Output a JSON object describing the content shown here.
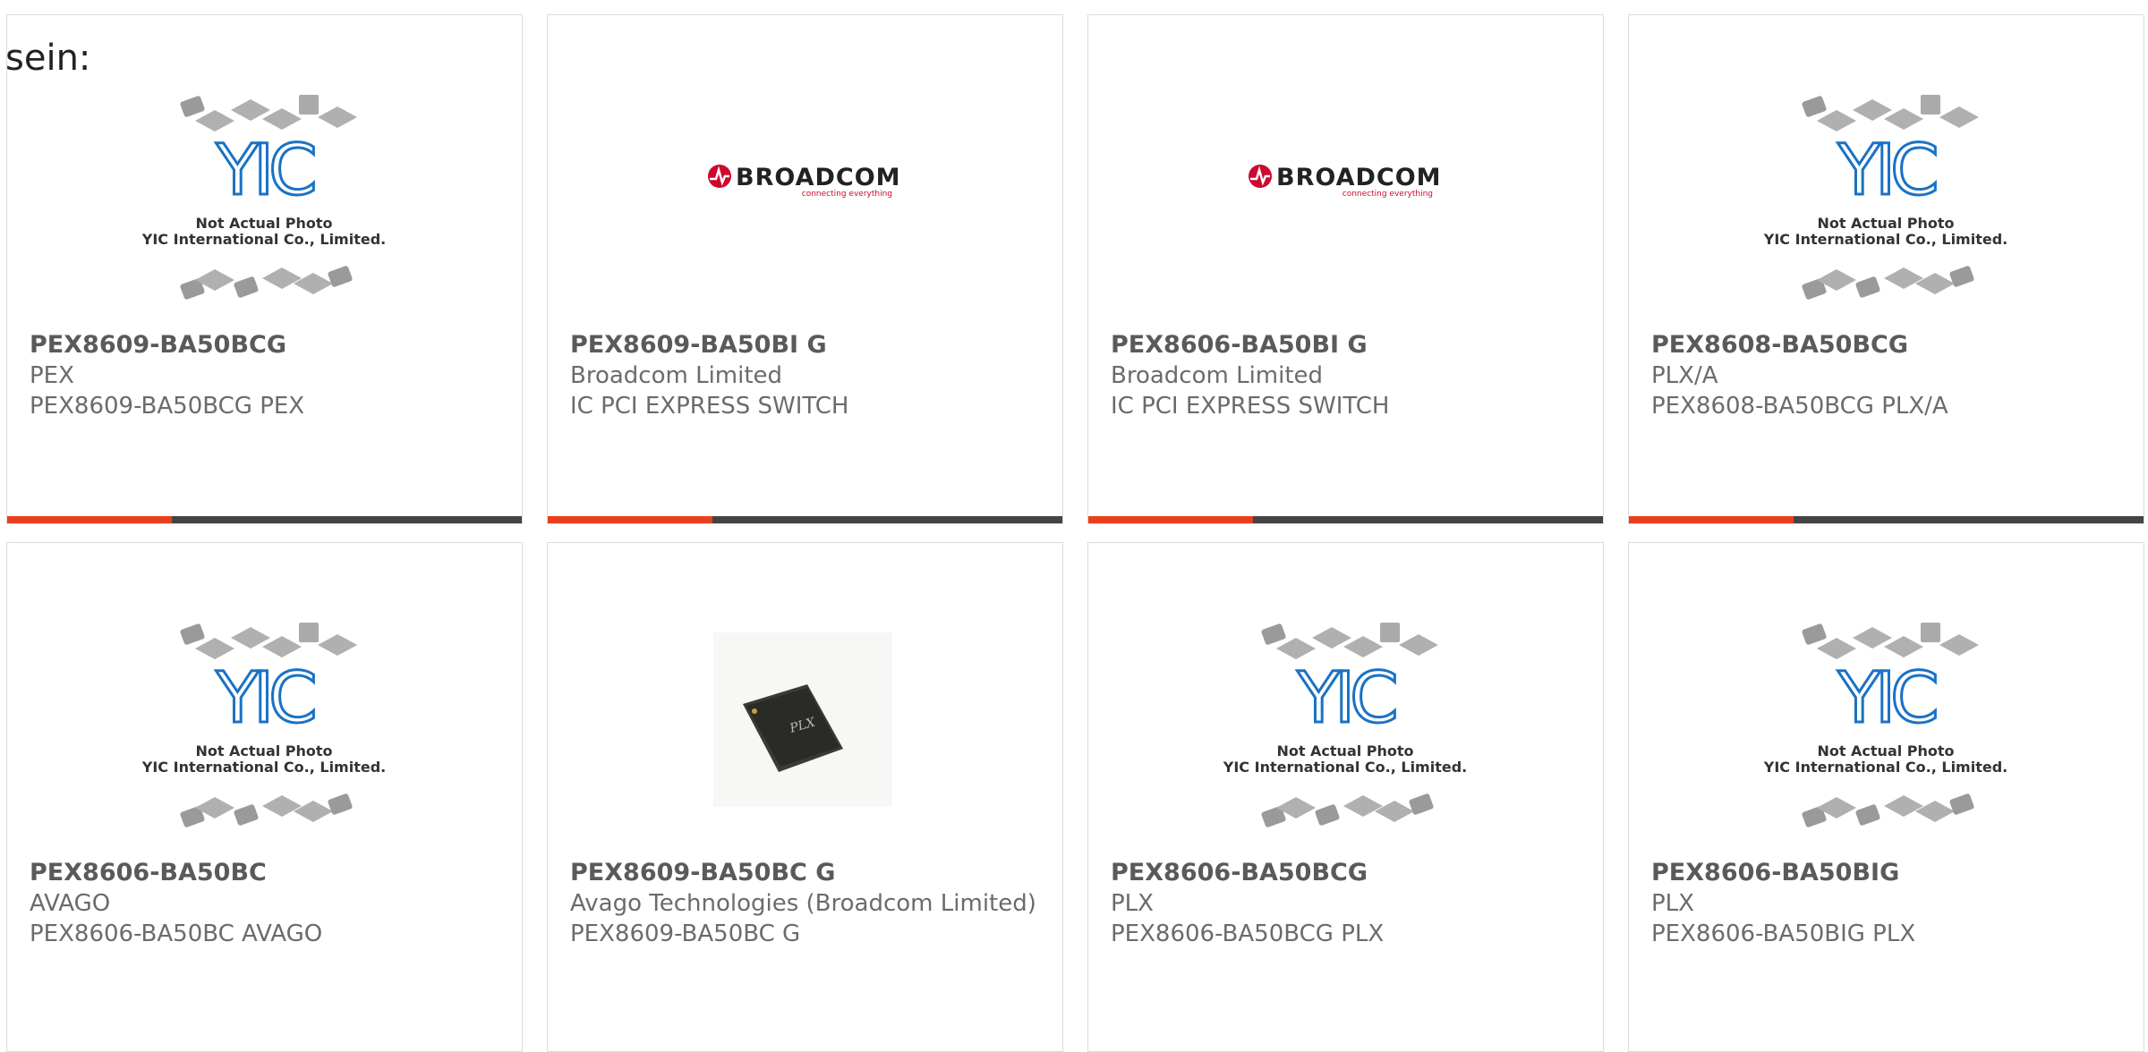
{
  "intro_text": "sein:",
  "placeholder": {
    "line1": "Not Actual Photo",
    "line2": "YIC International Co., Limited.",
    "logo": "YIC"
  },
  "broadcom_logo": {
    "name": "BROADCOM",
    "tagline": "connecting everything"
  },
  "chip_photo_label": "PLX",
  "colors": {
    "accent": "#e8401c",
    "bar": "#444444",
    "yic_blue": "#1a72c4",
    "broadcom_red": "#cc092f"
  },
  "products": [
    {
      "part": "PEX8609-BA50BCG",
      "manufacturer": "PEX",
      "description": "PEX8609-BA50BCG PEX",
      "image": "yic-placeholder",
      "progress": 0.32
    },
    {
      "part": "PEX8609-BA50BI G",
      "manufacturer": "Broadcom Limited",
      "description": "IC PCI EXPRESS SWITCH",
      "image": "broadcom-logo",
      "progress": 0.32
    },
    {
      "part": "PEX8606-BA50BI G",
      "manufacturer": "Broadcom Limited",
      "description": "IC PCI EXPRESS SWITCH",
      "image": "broadcom-logo",
      "progress": 0.32
    },
    {
      "part": "PEX8608-BA50BCG",
      "manufacturer": "PLX/A",
      "description": "PEX8608-BA50BCG PLX/A",
      "image": "yic-placeholder",
      "progress": 0.32
    },
    {
      "part": "PEX8606-BA50BC",
      "manufacturer": "AVAGO",
      "description": "PEX8606-BA50BC AVAGO",
      "image": "yic-placeholder",
      "progress": 0
    },
    {
      "part": "PEX8609-BA50BC G",
      "manufacturer": "Avago Technologies (Broadcom Limited)",
      "description": "PEX8609-BA50BC G",
      "image": "chip-photo",
      "progress": 0
    },
    {
      "part": "PEX8606-BA50BCG",
      "manufacturer": "PLX",
      "description": "PEX8606-BA50BCG PLX",
      "image": "yic-placeholder",
      "progress": 0
    },
    {
      "part": "PEX8606-BA50BIG",
      "manufacturer": "PLX",
      "description": "PEX8606-BA50BIG PLX",
      "image": "yic-placeholder",
      "progress": 0
    }
  ]
}
